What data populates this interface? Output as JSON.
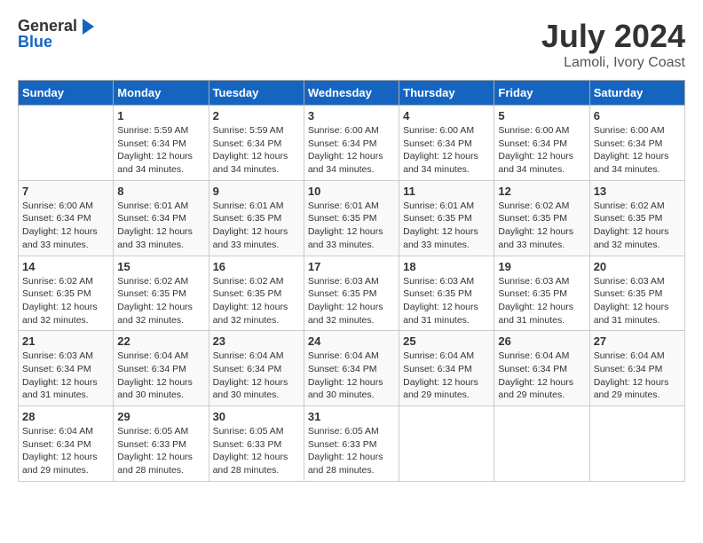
{
  "header": {
    "logo_general": "General",
    "logo_blue": "Blue",
    "title": "July 2024",
    "subtitle": "Lamoli, Ivory Coast"
  },
  "weekdays": [
    "Sunday",
    "Monday",
    "Tuesday",
    "Wednesday",
    "Thursday",
    "Friday",
    "Saturday"
  ],
  "weeks": [
    [
      {
        "day": "",
        "info": ""
      },
      {
        "day": "1",
        "info": "Sunrise: 5:59 AM\nSunset: 6:34 PM\nDaylight: 12 hours\nand 34 minutes."
      },
      {
        "day": "2",
        "info": "Sunrise: 5:59 AM\nSunset: 6:34 PM\nDaylight: 12 hours\nand 34 minutes."
      },
      {
        "day": "3",
        "info": "Sunrise: 6:00 AM\nSunset: 6:34 PM\nDaylight: 12 hours\nand 34 minutes."
      },
      {
        "day": "4",
        "info": "Sunrise: 6:00 AM\nSunset: 6:34 PM\nDaylight: 12 hours\nand 34 minutes."
      },
      {
        "day": "5",
        "info": "Sunrise: 6:00 AM\nSunset: 6:34 PM\nDaylight: 12 hours\nand 34 minutes."
      },
      {
        "day": "6",
        "info": "Sunrise: 6:00 AM\nSunset: 6:34 PM\nDaylight: 12 hours\nand 34 minutes."
      }
    ],
    [
      {
        "day": "7",
        "info": "Sunrise: 6:00 AM\nSunset: 6:34 PM\nDaylight: 12 hours\nand 33 minutes."
      },
      {
        "day": "8",
        "info": "Sunrise: 6:01 AM\nSunset: 6:34 PM\nDaylight: 12 hours\nand 33 minutes."
      },
      {
        "day": "9",
        "info": "Sunrise: 6:01 AM\nSunset: 6:35 PM\nDaylight: 12 hours\nand 33 minutes."
      },
      {
        "day": "10",
        "info": "Sunrise: 6:01 AM\nSunset: 6:35 PM\nDaylight: 12 hours\nand 33 minutes."
      },
      {
        "day": "11",
        "info": "Sunrise: 6:01 AM\nSunset: 6:35 PM\nDaylight: 12 hours\nand 33 minutes."
      },
      {
        "day": "12",
        "info": "Sunrise: 6:02 AM\nSunset: 6:35 PM\nDaylight: 12 hours\nand 33 minutes."
      },
      {
        "day": "13",
        "info": "Sunrise: 6:02 AM\nSunset: 6:35 PM\nDaylight: 12 hours\nand 32 minutes."
      }
    ],
    [
      {
        "day": "14",
        "info": "Sunrise: 6:02 AM\nSunset: 6:35 PM\nDaylight: 12 hours\nand 32 minutes."
      },
      {
        "day": "15",
        "info": "Sunrise: 6:02 AM\nSunset: 6:35 PM\nDaylight: 12 hours\nand 32 minutes."
      },
      {
        "day": "16",
        "info": "Sunrise: 6:02 AM\nSunset: 6:35 PM\nDaylight: 12 hours\nand 32 minutes."
      },
      {
        "day": "17",
        "info": "Sunrise: 6:03 AM\nSunset: 6:35 PM\nDaylight: 12 hours\nand 32 minutes."
      },
      {
        "day": "18",
        "info": "Sunrise: 6:03 AM\nSunset: 6:35 PM\nDaylight: 12 hours\nand 31 minutes."
      },
      {
        "day": "19",
        "info": "Sunrise: 6:03 AM\nSunset: 6:35 PM\nDaylight: 12 hours\nand 31 minutes."
      },
      {
        "day": "20",
        "info": "Sunrise: 6:03 AM\nSunset: 6:35 PM\nDaylight: 12 hours\nand 31 minutes."
      }
    ],
    [
      {
        "day": "21",
        "info": "Sunrise: 6:03 AM\nSunset: 6:34 PM\nDaylight: 12 hours\nand 31 minutes."
      },
      {
        "day": "22",
        "info": "Sunrise: 6:04 AM\nSunset: 6:34 PM\nDaylight: 12 hours\nand 30 minutes."
      },
      {
        "day": "23",
        "info": "Sunrise: 6:04 AM\nSunset: 6:34 PM\nDaylight: 12 hours\nand 30 minutes."
      },
      {
        "day": "24",
        "info": "Sunrise: 6:04 AM\nSunset: 6:34 PM\nDaylight: 12 hours\nand 30 minutes."
      },
      {
        "day": "25",
        "info": "Sunrise: 6:04 AM\nSunset: 6:34 PM\nDaylight: 12 hours\nand 29 minutes."
      },
      {
        "day": "26",
        "info": "Sunrise: 6:04 AM\nSunset: 6:34 PM\nDaylight: 12 hours\nand 29 minutes."
      },
      {
        "day": "27",
        "info": "Sunrise: 6:04 AM\nSunset: 6:34 PM\nDaylight: 12 hours\nand 29 minutes."
      }
    ],
    [
      {
        "day": "28",
        "info": "Sunrise: 6:04 AM\nSunset: 6:34 PM\nDaylight: 12 hours\nand 29 minutes."
      },
      {
        "day": "29",
        "info": "Sunrise: 6:05 AM\nSunset: 6:33 PM\nDaylight: 12 hours\nand 28 minutes."
      },
      {
        "day": "30",
        "info": "Sunrise: 6:05 AM\nSunset: 6:33 PM\nDaylight: 12 hours\nand 28 minutes."
      },
      {
        "day": "31",
        "info": "Sunrise: 6:05 AM\nSunset: 6:33 PM\nDaylight: 12 hours\nand 28 minutes."
      },
      {
        "day": "",
        "info": ""
      },
      {
        "day": "",
        "info": ""
      },
      {
        "day": "",
        "info": ""
      }
    ]
  ]
}
